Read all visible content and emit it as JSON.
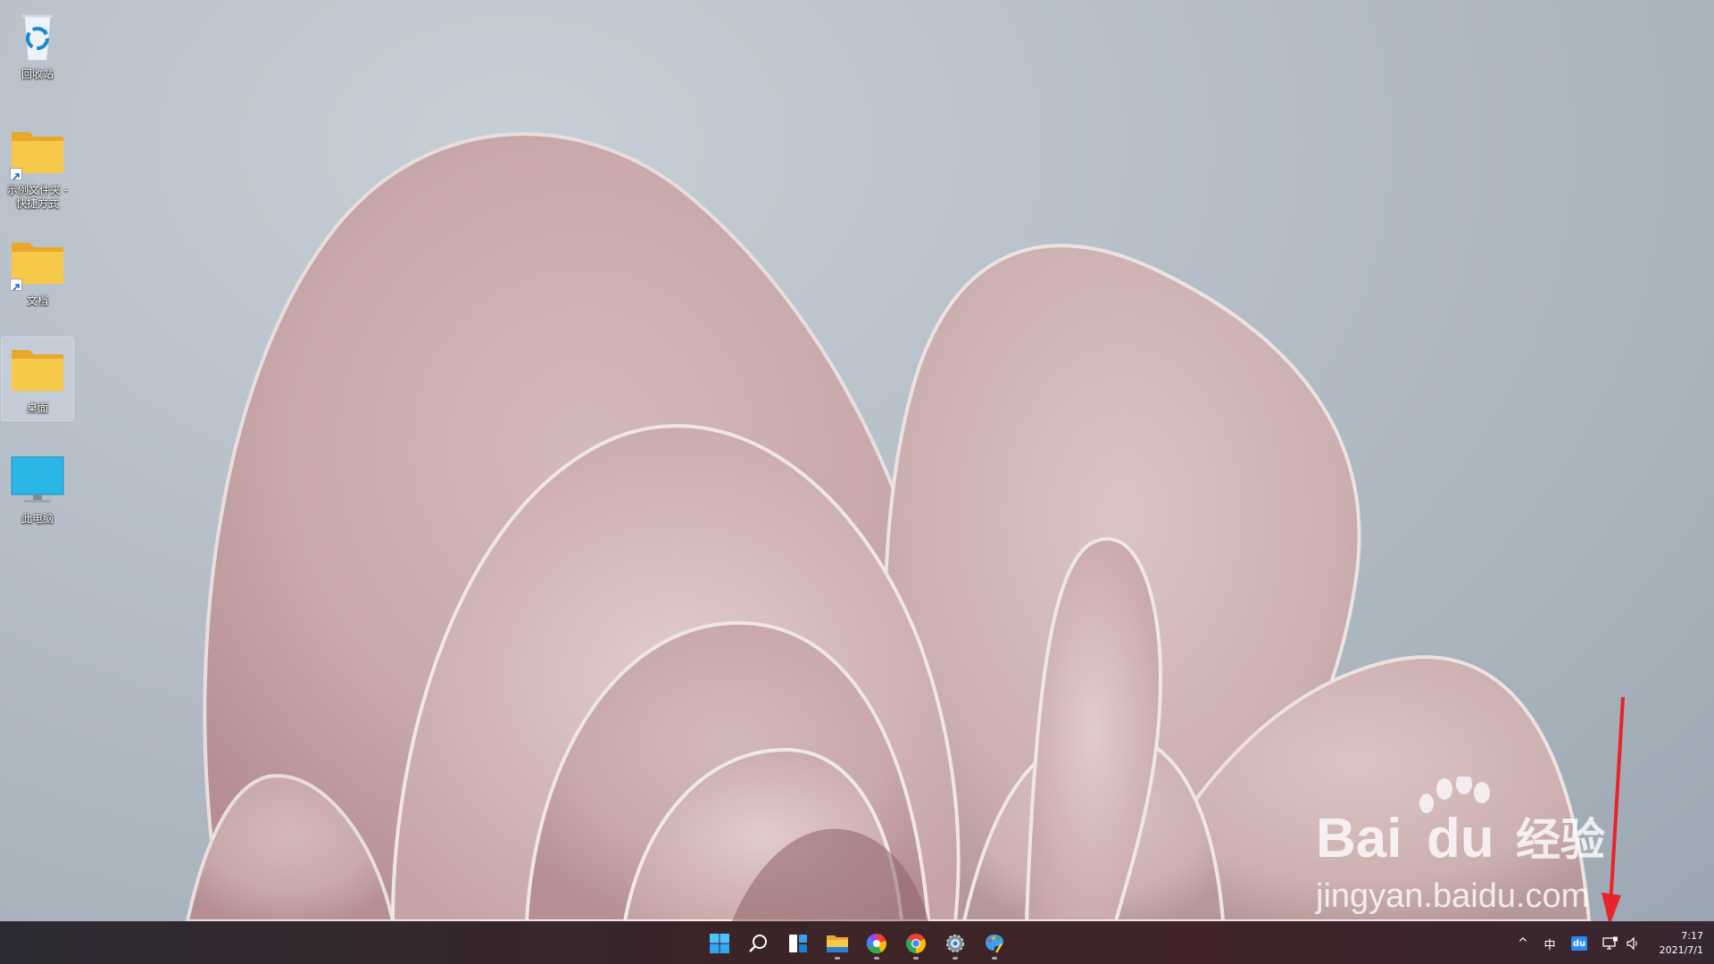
{
  "desktop": {
    "icons": [
      {
        "label": "回收站",
        "icon": "recycle-bin-icon"
      },
      {
        "label": "示例文件夹 - 快捷方式",
        "icon": "folder-shortcut-icon"
      },
      {
        "label": "文档",
        "icon": "folder-shortcut-icon"
      },
      {
        "label": "桌面",
        "icon": "folder-icon",
        "selected": true
      },
      {
        "label": "此电脑",
        "icon": "monitor-icon"
      }
    ]
  },
  "taskbar": {
    "apps": [
      {
        "name": "start",
        "icon": "windows-start-icon"
      },
      {
        "name": "search",
        "icon": "search-icon"
      },
      {
        "name": "widgets",
        "icon": "widgets-icon"
      },
      {
        "name": "file-explorer",
        "icon": "folder-icon",
        "running": true
      },
      {
        "name": "color-app",
        "icon": "color-wheel-icon",
        "running": true
      },
      {
        "name": "chrome",
        "icon": "chrome-icon",
        "running": true
      },
      {
        "name": "settings",
        "icon": "gear-icon",
        "running": true
      },
      {
        "name": "paint",
        "icon": "paint-palette-icon",
        "running": true
      }
    ],
    "tray": {
      "chevron": "^",
      "ime": "中",
      "baidu_badge": "du",
      "time": "7:17",
      "date": "2021/7/1"
    }
  },
  "watermark": {
    "brand_left": "Bai",
    "brand_right": "du",
    "brand_cn": "经验",
    "url": "jingyan.baidu.com"
  },
  "colors": {
    "annotation_arrow": "#e8232a",
    "folder_yellow": "#f7c948",
    "taskbar_bg": "#3b2427"
  }
}
